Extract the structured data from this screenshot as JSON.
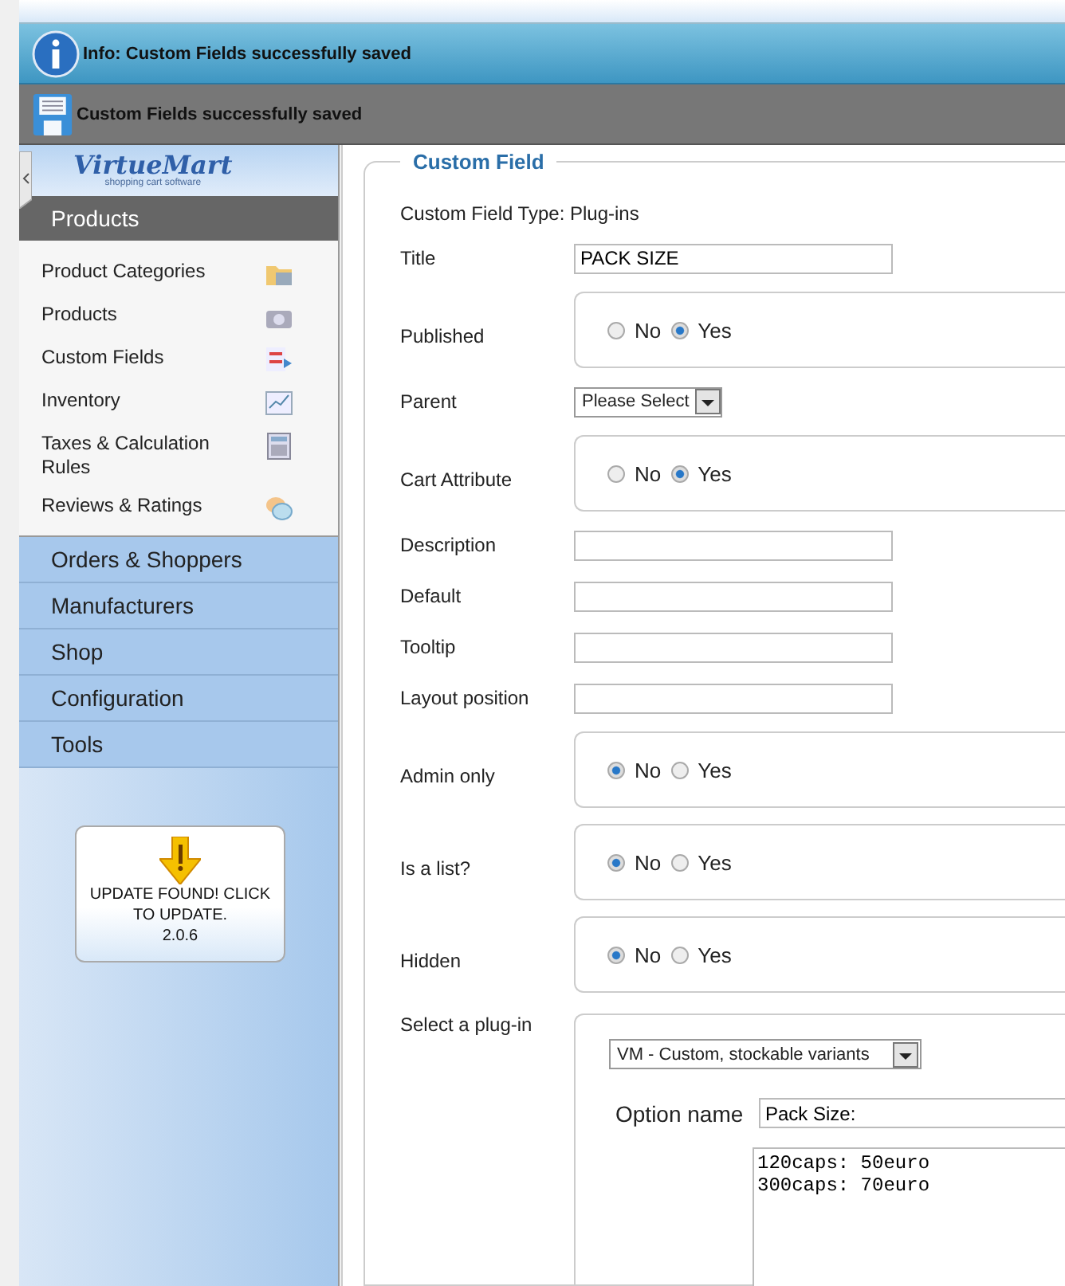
{
  "info_message": "Info: Custom Fields successfully saved",
  "save_message": "Custom Fields successfully saved",
  "logo": {
    "name": "VirtueMart",
    "tagline": "shopping cart software"
  },
  "sidebar": {
    "active_section": "Products",
    "sub_items": [
      {
        "label": "Product Categories",
        "kind": "folder"
      },
      {
        "label": "Products",
        "kind": "camera"
      },
      {
        "label": "Custom Fields",
        "kind": "form"
      },
      {
        "label": "Inventory",
        "kind": "chart"
      },
      {
        "label": "Taxes & Calculation Rules",
        "kind": "calculator"
      },
      {
        "label": "Reviews & Ratings",
        "kind": "speech"
      }
    ],
    "sections": [
      "Orders & Shoppers",
      "Manufacturers",
      "Shop",
      "Configuration",
      "Tools"
    ],
    "update": {
      "text": "UPDATE FOUND! CLICK TO UPDATE.",
      "version": "2.0.6"
    }
  },
  "form": {
    "legend": "Custom Field",
    "rows": [
      {
        "kind": "text",
        "label": "Custom Field Type:",
        "value": "Plug-ins"
      },
      {
        "kind": "input",
        "label": "Title",
        "value": "PACK SIZE"
      },
      {
        "kind": "radio",
        "label": "Published",
        "options": [
          {
            "label": "No",
            "selected": false
          },
          {
            "label": "Yes",
            "selected": true
          }
        ]
      },
      {
        "kind": "select",
        "label": "Parent",
        "value": "Please Select"
      },
      {
        "kind": "radio",
        "label": "Cart Attribute",
        "options": [
          {
            "label": "No",
            "selected": false
          },
          {
            "label": "Yes",
            "selected": true
          }
        ]
      },
      {
        "kind": "input",
        "label": "Description"
      },
      {
        "kind": "input",
        "label": "Default"
      },
      {
        "kind": "input",
        "label": "Tooltip"
      },
      {
        "kind": "input",
        "label": "Layout position"
      },
      {
        "kind": "radio",
        "label": "Admin only",
        "options": [
          {
            "label": "No",
            "selected": true
          },
          {
            "label": "Yes",
            "selected": false
          }
        ]
      },
      {
        "kind": "radio",
        "label": "Is a list?",
        "options": [
          {
            "label": "No",
            "selected": true
          },
          {
            "label": "Yes",
            "selected": false
          }
        ]
      },
      {
        "kind": "radio",
        "label": "Hidden",
        "options": [
          {
            "label": "No",
            "selected": true
          },
          {
            "label": "Yes",
            "selected": false
          }
        ]
      },
      {
        "kind": "plugin",
        "label": "Select a plug-in",
        "value": "VM - Custom, stockable variants",
        "option_label": "Option name",
        "option_value": "Pack Size:",
        "options_text": "120caps: 50euro\n300caps: 70euro"
      }
    ]
  }
}
